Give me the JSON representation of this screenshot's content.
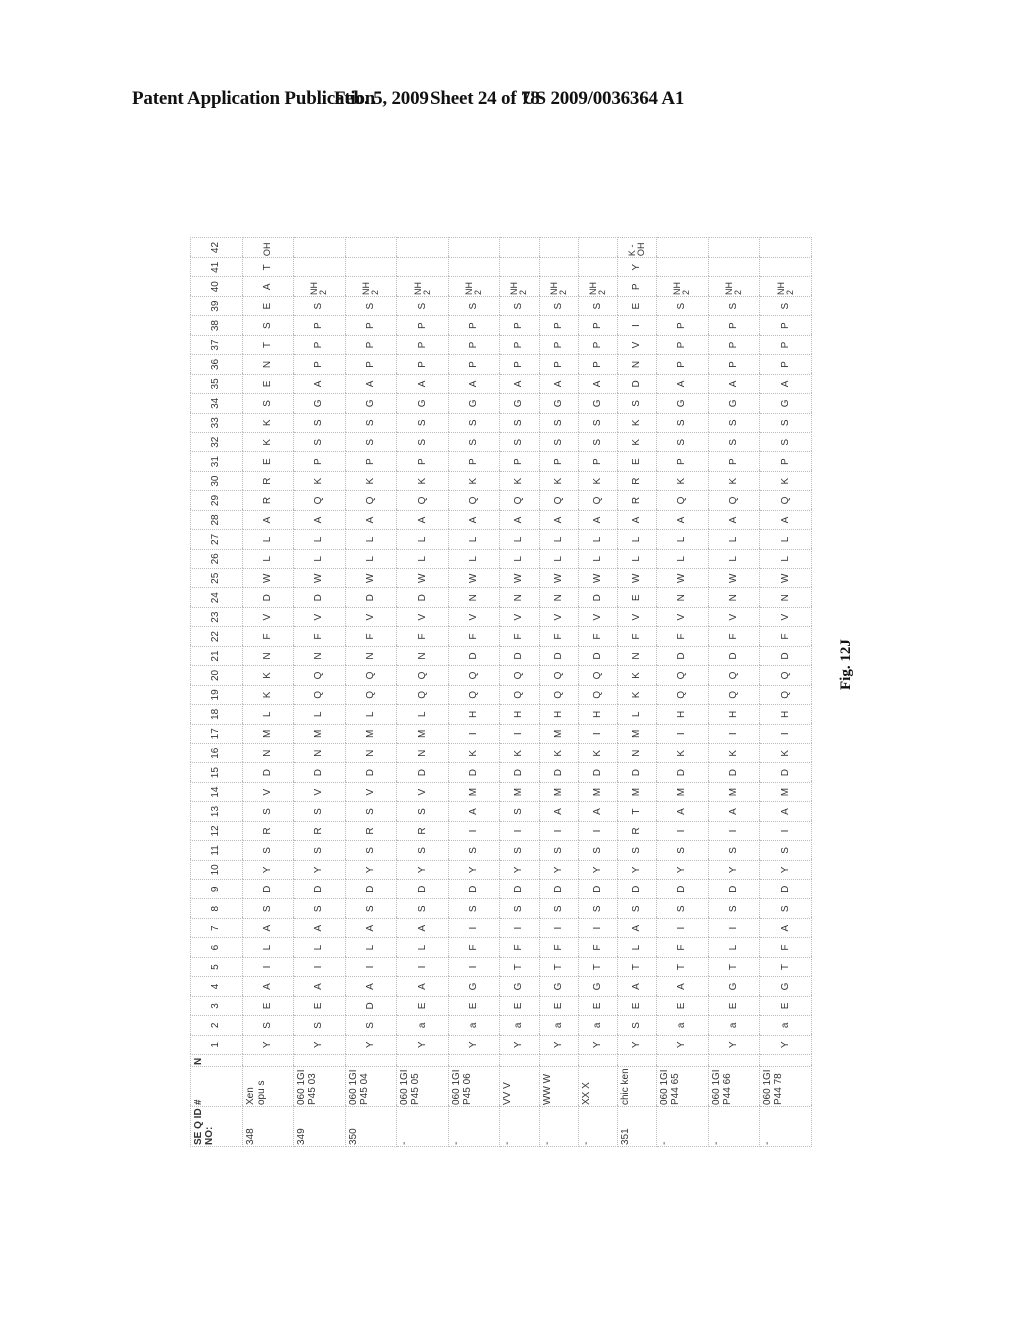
{
  "header": {
    "publication": "Patent Application Publication",
    "date": "Feb. 5, 2009",
    "sheet": "Sheet 24 of 78",
    "number": "US 2009/0036364 A1"
  },
  "table": {
    "col_seq_id": "SE Q ID NO:",
    "col_hash": "#",
    "col_n": "N",
    "positions": [
      "1",
      "2",
      "3",
      "4",
      "5",
      "6",
      "7",
      "8",
      "9",
      "10",
      "11",
      "12",
      "13",
      "14",
      "15",
      "16",
      "17",
      "18",
      "19",
      "20",
      "21",
      "22",
      "23",
      "24",
      "25",
      "26",
      "27",
      "28",
      "29",
      "30",
      "31",
      "32",
      "33",
      "34",
      "35",
      "36",
      "37",
      "38",
      "39",
      "40",
      "41",
      "42"
    ],
    "rows": [
      {
        "seq_id": "348",
        "name": "Xen opu s",
        "residues": [
          "Y",
          "S",
          "E",
          "A",
          "I",
          "L",
          "A",
          "S",
          "D",
          "Y",
          "S",
          "R",
          "S",
          "V",
          "D",
          "N",
          "M",
          "L",
          "K",
          "K",
          "N",
          "F",
          "V",
          "D",
          "W",
          "L",
          "L",
          "A",
          "R",
          "R",
          "E",
          "K",
          "K",
          "S",
          "E",
          "N",
          "T",
          "S",
          "E",
          "A",
          "T",
          "OH"
        ]
      },
      {
        "seq_id": "349",
        "name": "060 1GI P45 03",
        "residues": [
          "Y",
          "S",
          "E",
          "A",
          "I",
          "L",
          "A",
          "S",
          "D",
          "Y",
          "S",
          "R",
          "S",
          "V",
          "D",
          "N",
          "M",
          "L",
          "Q",
          "Q",
          "N",
          "F",
          "V",
          "D",
          "W",
          "L",
          "L",
          "A",
          "Q",
          "K",
          "P",
          "S",
          "S",
          "G",
          "A",
          "P",
          "P",
          "P",
          "S",
          "NH2",
          "",
          ""
        ]
      },
      {
        "seq_id": "350",
        "name": "060 1GI P45 04",
        "residues": [
          "Y",
          "S",
          "D",
          "A",
          "I",
          "L",
          "A",
          "S",
          "D",
          "Y",
          "S",
          "R",
          "S",
          "V",
          "D",
          "N",
          "M",
          "L",
          "Q",
          "Q",
          "N",
          "F",
          "V",
          "D",
          "W",
          "L",
          "L",
          "A",
          "Q",
          "K",
          "P",
          "S",
          "S",
          "G",
          "A",
          "P",
          "P",
          "P",
          "S",
          "NH2",
          "",
          ""
        ]
      },
      {
        "seq_id": "-",
        "name": "060 1GI P45 05",
        "residues": [
          "Y",
          "a",
          "E",
          "A",
          "I",
          "L",
          "A",
          "S",
          "D",
          "Y",
          "S",
          "R",
          "S",
          "V",
          "D",
          "N",
          "M",
          "L",
          "Q",
          "Q",
          "N",
          "F",
          "V",
          "D",
          "W",
          "L",
          "L",
          "A",
          "Q",
          "K",
          "P",
          "S",
          "S",
          "G",
          "A",
          "P",
          "P",
          "P",
          "S",
          "NH2",
          "",
          ""
        ]
      },
      {
        "seq_id": "-",
        "name": "060 1GI P45 06",
        "residues": [
          "Y",
          "a",
          "E",
          "G",
          "I",
          "F",
          "I",
          "S",
          "D",
          "Y",
          "S",
          "I",
          "A",
          "M",
          "D",
          "K",
          "I",
          "H",
          "Q",
          "Q",
          "D",
          "F",
          "V",
          "N",
          "W",
          "L",
          "L",
          "A",
          "Q",
          "K",
          "P",
          "S",
          "S",
          "G",
          "A",
          "P",
          "P",
          "P",
          "S",
          "NH2",
          "",
          ""
        ]
      },
      {
        "seq_id": "-",
        "name": "VV V",
        "residues": [
          "Y",
          "a",
          "E",
          "G",
          "T",
          "F",
          "I",
          "S",
          "D",
          "Y",
          "S",
          "I",
          "S",
          "M",
          "D",
          "K",
          "I",
          "H",
          "Q",
          "Q",
          "D",
          "F",
          "V",
          "N",
          "W",
          "L",
          "L",
          "A",
          "Q",
          "K",
          "P",
          "S",
          "S",
          "G",
          "A",
          "P",
          "P",
          "P",
          "S",
          "NH2",
          "",
          ""
        ]
      },
      {
        "seq_id": "-",
        "name": "WW W",
        "residues": [
          "Y",
          "a",
          "E",
          "G",
          "T",
          "F",
          "I",
          "S",
          "D",
          "Y",
          "S",
          "I",
          "A",
          "M",
          "D",
          "K",
          "M",
          "H",
          "Q",
          "Q",
          "D",
          "F",
          "V",
          "N",
          "W",
          "L",
          "L",
          "A",
          "Q",
          "K",
          "P",
          "S",
          "S",
          "G",
          "A",
          "P",
          "P",
          "P",
          "S",
          "NH2",
          "",
          ""
        ]
      },
      {
        "seq_id": "-",
        "name": "XX X",
        "residues": [
          "Y",
          "a",
          "E",
          "G",
          "T",
          "F",
          "I",
          "S",
          "D",
          "Y",
          "S",
          "I",
          "A",
          "M",
          "D",
          "K",
          "I",
          "H",
          "Q",
          "Q",
          "D",
          "F",
          "V",
          "D",
          "W",
          "L",
          "L",
          "A",
          "Q",
          "K",
          "P",
          "S",
          "S",
          "G",
          "A",
          "P",
          "P",
          "P",
          "S",
          "NH2",
          "",
          ""
        ]
      },
      {
        "seq_id": "351",
        "name": "chic ken",
        "residues": [
          "Y",
          "S",
          "E",
          "A",
          "T",
          "L",
          "A",
          "S",
          "D",
          "Y",
          "S",
          "R",
          "T",
          "M",
          "D",
          "N",
          "M",
          "L",
          "K",
          "K",
          "N",
          "F",
          "V",
          "E",
          "W",
          "L",
          "L",
          "A",
          "R",
          "R",
          "E",
          "K",
          "K",
          "S",
          "D",
          "N",
          "V",
          "I",
          "E",
          "P",
          "Y",
          "K -OH"
        ]
      },
      {
        "seq_id": "-",
        "name": "060 1GI P44 65",
        "residues": [
          "Y",
          "a",
          "E",
          "A",
          "T",
          "F",
          "I",
          "S",
          "D",
          "Y",
          "S",
          "I",
          "A",
          "M",
          "D",
          "K",
          "I",
          "H",
          "Q",
          "Q",
          "D",
          "F",
          "V",
          "N",
          "W",
          "L",
          "L",
          "A",
          "Q",
          "K",
          "P",
          "S",
          "S",
          "G",
          "A",
          "P",
          "P",
          "P",
          "S",
          "NH2",
          "",
          ""
        ]
      },
      {
        "seq_id": "-",
        "name": "060 1GI P44 66",
        "residues": [
          "Y",
          "a",
          "E",
          "G",
          "T",
          "L",
          "I",
          "S",
          "D",
          "Y",
          "S",
          "I",
          "A",
          "M",
          "D",
          "K",
          "I",
          "H",
          "Q",
          "Q",
          "D",
          "F",
          "V",
          "N",
          "W",
          "L",
          "L",
          "A",
          "Q",
          "K",
          "P",
          "S",
          "S",
          "G",
          "A",
          "P",
          "P",
          "P",
          "S",
          "NH2",
          "",
          ""
        ]
      },
      {
        "seq_id": "-",
        "name": "060 1GI P44 78",
        "residues": [
          "Y",
          "a",
          "E",
          "G",
          "T",
          "F",
          "A",
          "S",
          "D",
          "Y",
          "S",
          "I",
          "A",
          "M",
          "D",
          "K",
          "I",
          "H",
          "Q",
          "Q",
          "D",
          "F",
          "V",
          "N",
          "W",
          "L",
          "L",
          "A",
          "Q",
          "K",
          "P",
          "S",
          "S",
          "G",
          "A",
          "P",
          "P",
          "P",
          "S",
          "NH2",
          "",
          ""
        ]
      }
    ]
  },
  "figure_label": "Fig. 12J"
}
